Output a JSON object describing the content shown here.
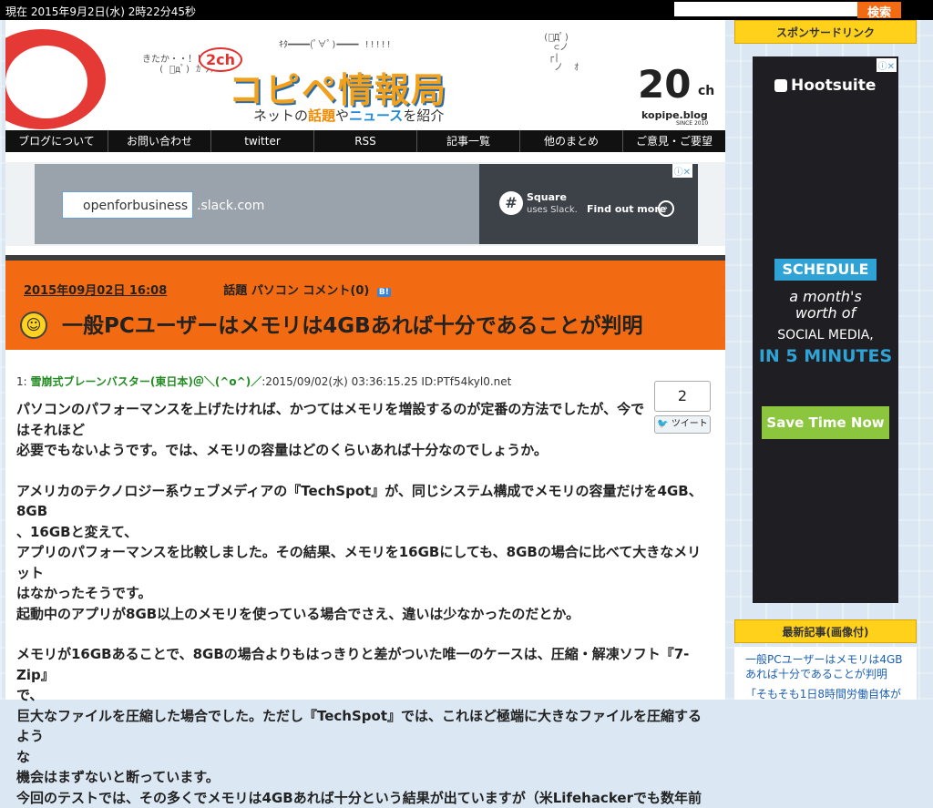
{
  "topbar": {
    "clock": "現在 2015年9月2日(水) 2時22分45秒",
    "search_placeholder": "",
    "search_button": "検索"
  },
  "header": {
    "badge": "2ch",
    "title": "コピペ情報局",
    "subtitle_parts": [
      "ネットの",
      "話題",
      "や",
      "ニュース",
      "を紹介"
    ],
    "ascii_left": "きたか・・！！\n   ( ﾟдﾟ) ｶﾞﾀｯ",
    "ascii_top": "ｷﾀ━━━━(ﾟ∀ﾟ)━━━━ !!!!!",
    "ascii_right": "(ﾟДﾟ)\n  ⊂ノ\n ┌|\n  ノ  ｵ",
    "corner_num": "20",
    "corner_ch": "ch",
    "corner_blog": "kopipe.blog",
    "corner_since": "SINCE 2010"
  },
  "nav": {
    "items": [
      "ブログについて",
      "お問い合わせ",
      "twitter",
      "RSS",
      "記事一覧",
      "他のまとめ",
      "ご意見・ご要望"
    ]
  },
  "ad_banner": {
    "input_text": "openforbusiness",
    "domain": ".slack.com",
    "sq_title": "Square",
    "sq_sub": "uses Slack.",
    "find_out": "Find out more",
    "ad_mark": "ⓘ✕"
  },
  "article": {
    "date": "2015年09月02日 16:08",
    "category_label": "話題",
    "category_value": "パソコン",
    "comments_label": "コメント(",
    "comments_count": "0",
    "comments_close": ")",
    "hatena": "B!",
    "title": "一般PCユーザーはメモリは4GBあれば十分であることが判明"
  },
  "post": {
    "number": "1:",
    "name": "雪崩式ブレーンバスター(東日本)＠＼(^o^)／",
    "meta": ":2015/09/02(水) 03:36:15.25 ID:PTf54kyl0.net",
    "counter": "2",
    "tweet": "ツイート",
    "paragraphs": [
      [
        "パソコンのパフォーマンスを上げたければ、かつてはメモリを増設するのが定番の方法でしたが、今で",
        "はそれほど",
        "必要でもないようです。では、メモリの容量はどのくらいあれば十分なのでしょうか。"
      ],
      [
        "アメリカのテクノロジー系ウェブメディアの『TechSpot』が、同じシステム構成でメモリの容量だけを4GB、8GB",
        "、16GBと変えて、",
        "アプリのパフォーマンスを比較しました。その結果、メモリを16GBにしても、8GBの場合に比べて大きなメリット",
        "はなかったそうです。",
        "起動中のアプリが8GB以上のメモリを使っている場合でさえ、違いは少なかったのだとか。"
      ],
      [
        "メモリが16GBあることで、8GBの場合よりもはっきりと差がついた唯一のケースは、圧縮・解凍ソフト『7-Zip』",
        "で、",
        "巨大なファイルを圧縮した場合でした。ただし『TechSpot』では、これほど極端に大きなファイルを圧縮するよう",
        "な",
        "機会はまずないと断っています。",
        "今回のテストでは、その多くでメモリは4GBあれば十分という結果が出ていますが（米Lifehackerでも数年前"
      ]
    ]
  },
  "sidebar": {
    "sponsored": "スポンサードリンク",
    "hootsuite": "Hootsuite",
    "ad_mark": "ⓘ✕",
    "schedule": "SCHEDULE",
    "line1": "a month's",
    "line2": "worth of",
    "line3": "SOCIAL MEDIA,",
    "line4": "IN 5 MINUTES",
    "button": "Save Time Now",
    "recent_head": "最新記事(画像付)",
    "recent_items": [
      "一般PCユーザーはメモリは4GBあれば十分であることが判明",
      "「そもそも1日8時間労働自体が"
    ]
  },
  "colors": {
    "accent": "#f26a11",
    "sidebar_head": "#ffd11a",
    "nav": "#111111",
    "hootsuite_btn": "#8cc63f"
  }
}
